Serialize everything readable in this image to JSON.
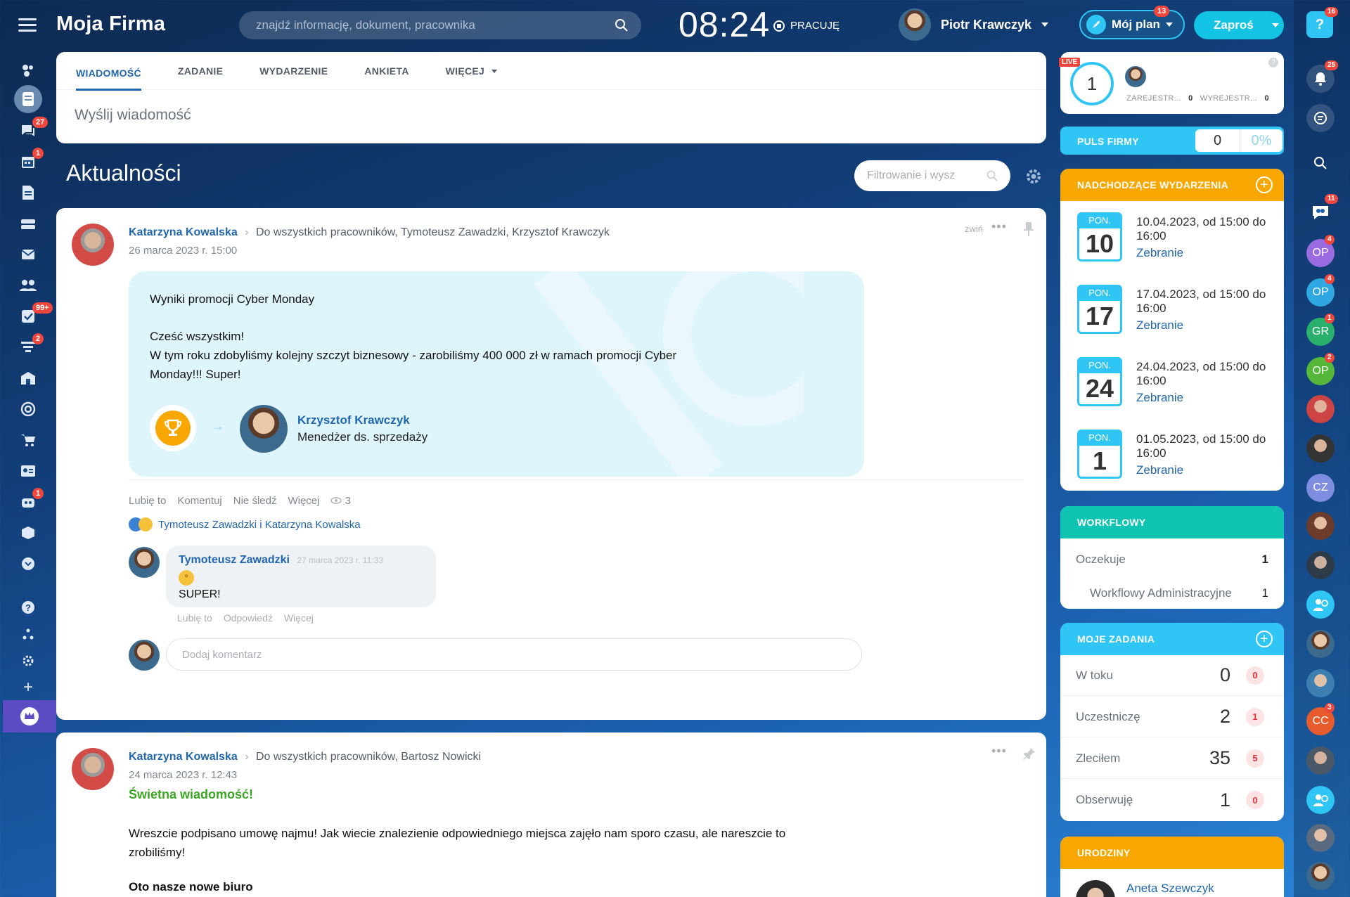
{
  "app": {
    "title": "Moja Firma",
    "search_placeholder": "znajdź informację, dokument, pracownika"
  },
  "clock": {
    "time": "08:24",
    "status": "PRACUJĘ"
  },
  "user": {
    "name": "Piotr Krawczyk"
  },
  "plan": {
    "label": "Mój plan",
    "badge": "13"
  },
  "invite": {
    "label": "Zaproś"
  },
  "help_badge": "16",
  "left_badges": {
    "chat": "27",
    "calendar": "1",
    "tasks": "99+",
    "crm": "2",
    "robot": "1"
  },
  "composer": {
    "tabs": [
      "WIADOMOŚĆ",
      "ZADANIE",
      "WYDARZENIE",
      "ANKIETA",
      "WIĘCEJ"
    ],
    "placeholder": "Wyślij wiadomość"
  },
  "feed": {
    "title": "Aktualności",
    "filter_placeholder": "Filtrowanie i wysz"
  },
  "post1": {
    "author": "Katarzyna Kowalska",
    "recipients": "Do wszystkich pracowników, Tymoteusz Zawadzki, Krzysztof Krawczyk",
    "date": "26 marca 2023 r. 15:00",
    "collapse": "zwiń",
    "lines": [
      "Wyniki promocji Cyber Monday",
      "Cześć wszystkim!",
      "W tym roku zdobyliśmy kolejny szczyt biznesowy - zarobiliśmy 400 000 zł w ramach promocji Cyber Monday!!! Super!"
    ],
    "award_name": "Krzysztof Krawczyk",
    "award_role": "Menedżer ds. sprzedaży",
    "actions": [
      "Lubię to",
      "Komentuj",
      "Nie śledź",
      "Więcej"
    ],
    "views": "3",
    "likes": "Tymoteusz Zawadzki i Katarzyna Kowalska",
    "comment": {
      "author": "Tymoteusz Zawadzki",
      "date": "27 marca 2023 r. 11:33",
      "text": "SUPER!",
      "actions": [
        "Lubię to",
        "Odpowiedź",
        "Więcej"
      ]
    },
    "add_comment": "Dodaj komentarz"
  },
  "post2": {
    "author": "Katarzyna Kowalska",
    "recipients": "Do wszystkich pracowników, Bartosz Nowicki",
    "date": "24 marca 2023 r. 12:43",
    "headline": "Świetna wiadomość!",
    "text": "Wreszcie podpisano umowę najmu! Jak wiecie znalezienie odpowiedniego miejsca zajęło nam sporo czasu, ale nareszcie to zrobiliśmy!",
    "subhead": "Oto nasze nowe biuro"
  },
  "live": {
    "tag": "LIVE",
    "count": "1",
    "registered_label": "ZAREJESTR...",
    "registered": "0",
    "unregistered_label": "WYREJESTR...",
    "unregistered": "0"
  },
  "pulse": {
    "label": "PULS FIRMY",
    "value": "0",
    "percent": "0%"
  },
  "events": {
    "title": "NADCHODZĄCE WYDARZENIA",
    "items": [
      {
        "day": "PON.",
        "num": "10",
        "time": "10.04.2023, od 15:00 do 16:00",
        "name": "Zebranie"
      },
      {
        "day": "PON.",
        "num": "17",
        "time": "17.04.2023, od 15:00 do 16:00",
        "name": "Zebranie"
      },
      {
        "day": "PON.",
        "num": "24",
        "time": "24.04.2023, od 15:00 do 16:00",
        "name": "Zebranie"
      },
      {
        "day": "PON.",
        "num": "1",
        "time": "01.05.2023, od 15:00 do 16:00",
        "name": "Zebranie"
      }
    ]
  },
  "workflows": {
    "title": "WORKFLOWY",
    "rows": [
      {
        "label": "Oczekuje",
        "value": "1"
      },
      {
        "label": "Workflowy Administracyjne",
        "value": "1"
      }
    ]
  },
  "tasks": {
    "title": "MOJE ZADANIA",
    "rows": [
      {
        "label": "W toku",
        "value": "0",
        "counter": "0"
      },
      {
        "label": "Uczestniczę",
        "value": "2",
        "counter": "1"
      },
      {
        "label": "Zleciłem",
        "value": "35",
        "counter": "5"
      },
      {
        "label": "Obserwuję",
        "value": "1",
        "counter": "0"
      }
    ]
  },
  "birthdays": {
    "title": "URODZINY",
    "first": "Aneta Szewczyk"
  },
  "right_rail": {
    "badges": {
      "notifications": "25",
      "chat": "11"
    },
    "chats": [
      {
        "initials": "OP",
        "badge": "4",
        "color": "#9a6ae0"
      },
      {
        "initials": "OP",
        "badge": "4",
        "color": "#2fa7e0"
      },
      {
        "initials": "GR",
        "badge": "1",
        "color": "#29b06c"
      },
      {
        "initials": "OP",
        "badge": "2",
        "color": "#55b83a"
      },
      {
        "initials": "CZ",
        "badge": "",
        "color": "#7e8de0"
      },
      {
        "initials": "CC",
        "badge": "3",
        "color": "#e85b2c"
      }
    ]
  },
  "colors": {
    "accent": "#2067b0",
    "cyan": "#2fc6f6",
    "orange": "#f7a700",
    "teal": "#10c4b4",
    "danger": "#f0463c"
  }
}
